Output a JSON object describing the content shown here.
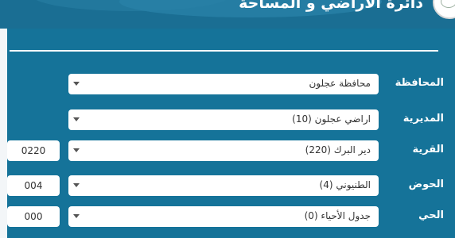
{
  "header": {
    "title": "دائرة الأراضي و المساحة"
  },
  "form": {
    "rows": [
      {
        "label": "المحافظة",
        "value": "محافظة عجلون",
        "code": ""
      },
      {
        "label": "المديرية",
        "value": "اراضي عجلون (10)",
        "code": ""
      },
      {
        "label": "القرية",
        "value": "دير البرك (220)",
        "code": "0220"
      },
      {
        "label": "الحوض",
        "value": "الطنيوني (4)",
        "code": "004"
      },
      {
        "label": "الحي",
        "value": "جدول الأحياء (0)",
        "code": "000"
      }
    ]
  },
  "icons": {
    "caret": "chevron-down-icon",
    "logo": "emblem-logo"
  },
  "colors": {
    "background": "#157399",
    "header": "#1a6e93",
    "field": "#ffffff"
  }
}
